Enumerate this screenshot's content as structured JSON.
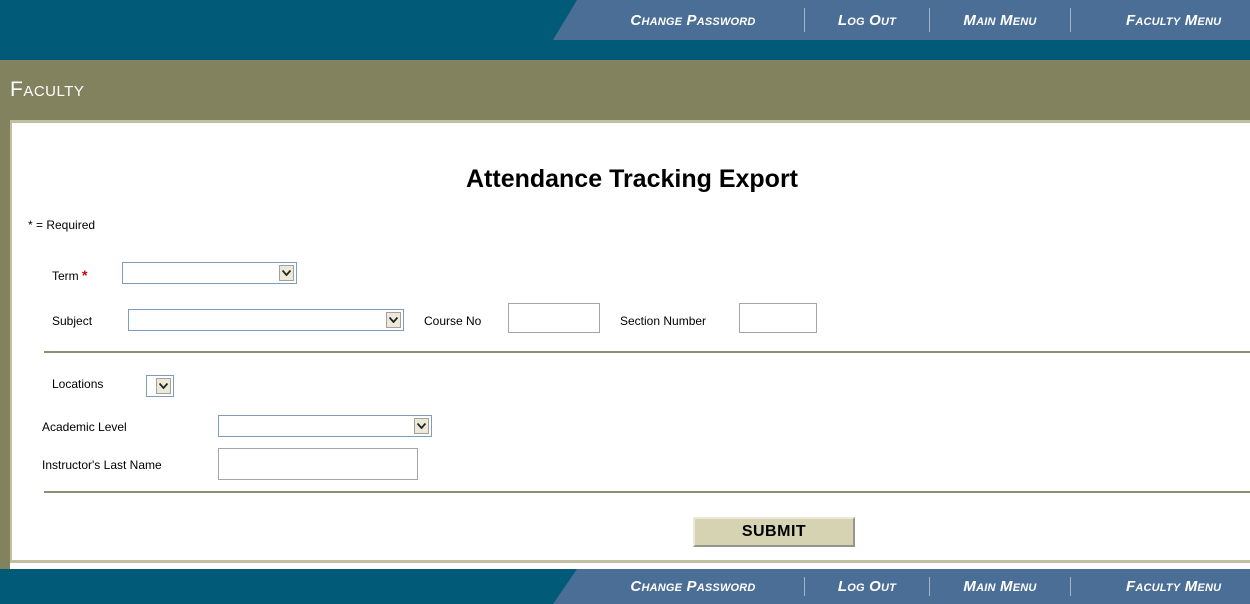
{
  "nav": {
    "change_password": "Change Password",
    "log_out": "Log Out",
    "main_menu": "Main Menu",
    "faculty_menu": "Faculty Menu"
  },
  "section": {
    "title": "Faculty"
  },
  "page": {
    "title": "Attendance Tracking Export"
  },
  "form": {
    "required_note": "* = Required",
    "term_label": "Term",
    "required_marker": "*",
    "term_value": "",
    "subject_label": "Subject",
    "subject_value": "",
    "course_no_label": "Course No",
    "course_no_value": "",
    "section_number_label": "Section Number",
    "section_number_value": "",
    "locations_label": "Locations",
    "locations_value": "",
    "academic_level_label": "Academic Level",
    "academic_level_value": "",
    "instructor_last_name_label": "Instructor's Last Name",
    "instructor_last_name_value": "",
    "submit_label": "SUBMIT"
  },
  "colors": {
    "nav_bg": "#005a78",
    "nav_slant": "#4a6e95",
    "section_bg": "#82825f",
    "submit_bg": "#d6d3b2",
    "required_star": "#d00000"
  },
  "icons": {
    "dropdown": "chevron-down-icon"
  }
}
